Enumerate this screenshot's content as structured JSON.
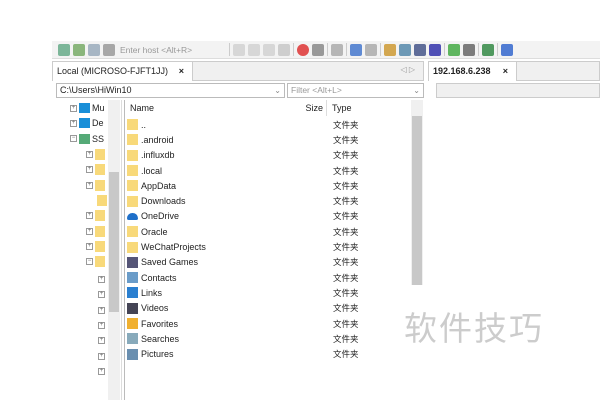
{
  "toolbar": {
    "host_placeholder": "Enter host <Alt+R>",
    "icons": [
      "connect-icon",
      "quick-connect-icon",
      "reconnect-icon",
      "disconnect-icon",
      "cut-icon",
      "copy-icon",
      "paste-icon",
      "rename-icon",
      "delete-icon",
      "close-icon",
      "properties-icon",
      "view-icon",
      "view2-icon",
      "sort-icon",
      "tree-icon",
      "list-icon",
      "details-icon",
      "sync-icon",
      "pin-icon",
      "console-icon",
      "help-icon"
    ]
  },
  "left_tab": {
    "label": "Local (MICROSO-FJFT1JJ)",
    "close": "×",
    "nav": "◁ ▷"
  },
  "right_tab": {
    "label": "192.168.6.238",
    "close": "×"
  },
  "path": {
    "value": "C:\\Users\\HiWin10"
  },
  "filter": {
    "placeholder": "Filter <Alt+L>"
  },
  "tree": {
    "items": [
      "Mu",
      "De",
      "SS"
    ]
  },
  "list": {
    "headers": {
      "name": "Name",
      "size": "Size",
      "type": "Type"
    },
    "rows": [
      {
        "name": "..",
        "type": "文件夹",
        "icon": "folder"
      },
      {
        "name": ".android",
        "type": "文件夹",
        "icon": "folder"
      },
      {
        "name": ".influxdb",
        "type": "文件夹",
        "icon": "folder"
      },
      {
        "name": ".local",
        "type": "文件夹",
        "icon": "folder"
      },
      {
        "name": "AppData",
        "type": "文件夹",
        "icon": "folder"
      },
      {
        "name": "Downloads",
        "type": "文件夹",
        "icon": "folder"
      },
      {
        "name": "OneDrive",
        "type": "文件夹",
        "icon": "onedrive"
      },
      {
        "name": "Oracle",
        "type": "文件夹",
        "icon": "folder"
      },
      {
        "name": "WeChatProjects",
        "type": "文件夹",
        "icon": "folder"
      },
      {
        "name": "Saved Games",
        "type": "文件夹",
        "icon": "games"
      },
      {
        "name": "Contacts",
        "type": "文件夹",
        "icon": "contacts"
      },
      {
        "name": "Links",
        "type": "文件夹",
        "icon": "links"
      },
      {
        "name": "Videos",
        "type": "文件夹",
        "icon": "videos"
      },
      {
        "name": "Favorites",
        "type": "文件夹",
        "icon": "star"
      },
      {
        "name": "Searches",
        "type": "文件夹",
        "icon": "search"
      },
      {
        "name": "Pictures",
        "type": "文件夹",
        "icon": "pictures"
      }
    ]
  },
  "watermark": "软件技巧"
}
